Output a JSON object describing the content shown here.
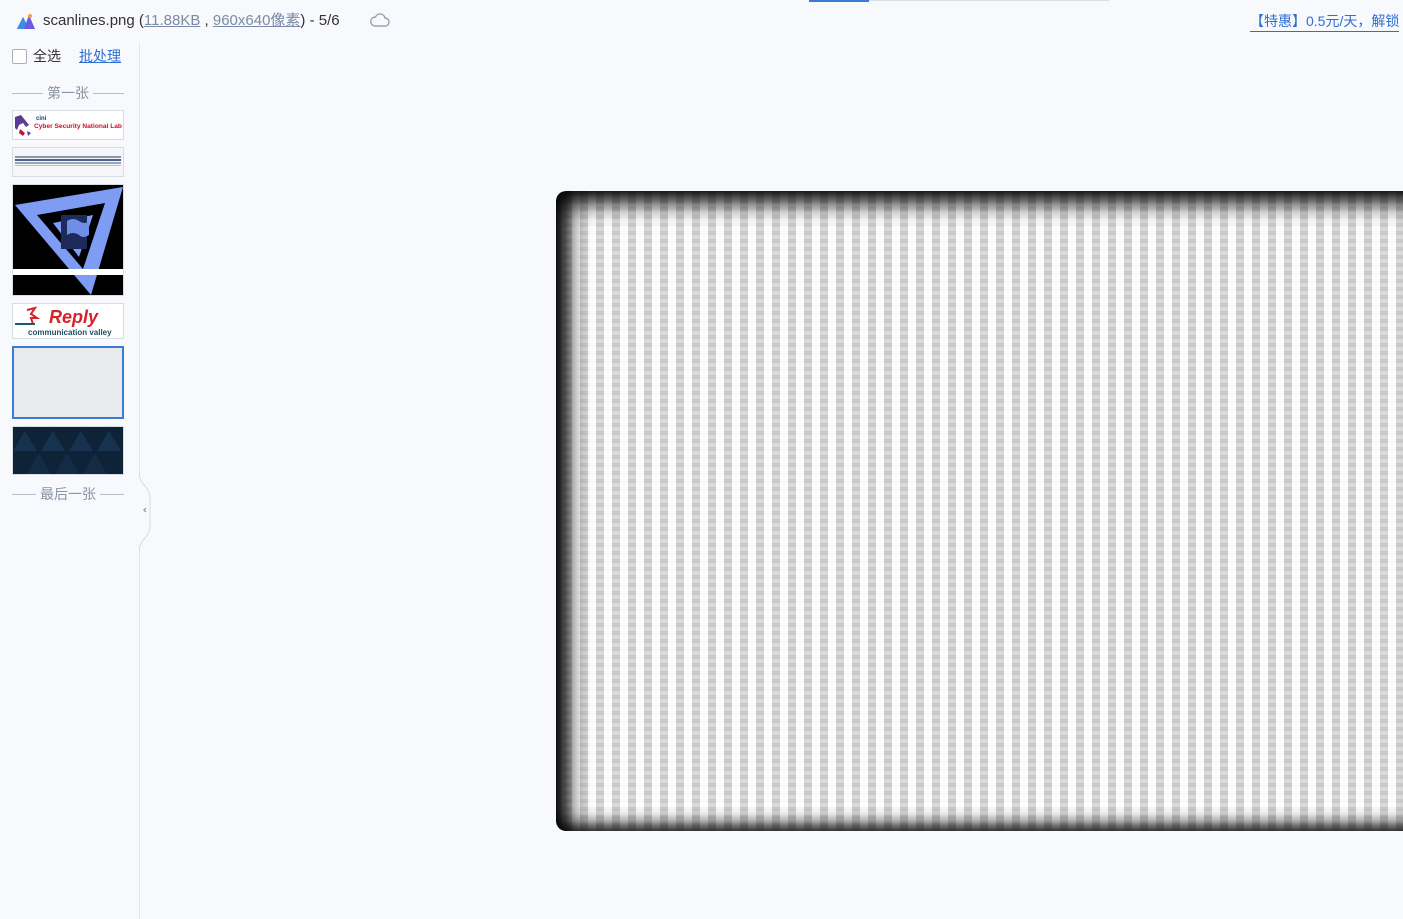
{
  "header": {
    "filename": "scanlines.png",
    "open_paren": " (",
    "filesize": "11.88KB",
    "separator": " , ",
    "dimensions": "960x640像素",
    "close_and_position": ") - 5/6",
    "promo": "【特惠】0.5元/天，解锁"
  },
  "sidebar": {
    "select_all_label": "全选",
    "batch_label": "批处理",
    "first_label": "第一张",
    "last_label": "最后一张",
    "thumbnails": [
      {
        "caption_small": "cini",
        "caption": "Cyber Security National Lab"
      },
      {
        "caption": ""
      },
      {
        "caption": ""
      },
      {
        "caption": "Reply",
        "subcaption": "communication valley"
      },
      {
        "caption": ""
      },
      {
        "caption": ""
      }
    ]
  },
  "colors": {
    "accent": "#3a7bd5",
    "link": "#2f6fd1",
    "promo": "#2f6fd1",
    "background": "#f8f9fc"
  },
  "icons": {
    "app": "app-logo-icon",
    "cloud": "cloud-icon",
    "collapse": "chevron-left-icon"
  }
}
